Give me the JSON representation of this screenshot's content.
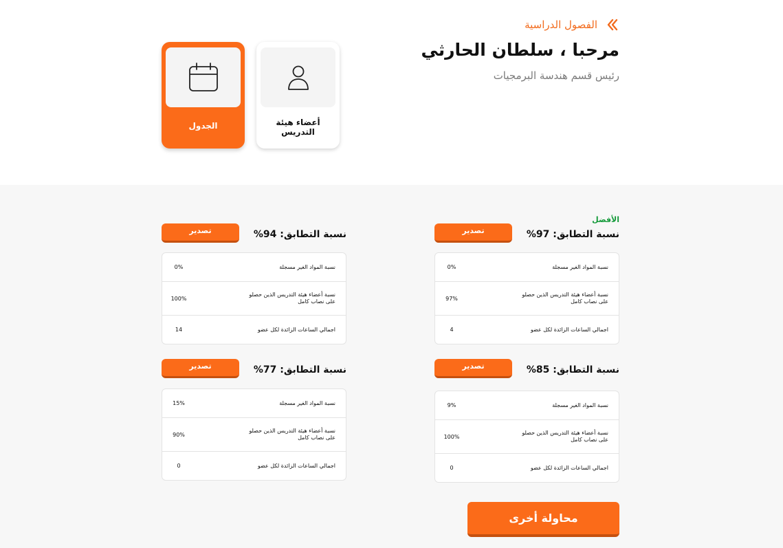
{
  "header": {
    "breadcrumb": "الفصول الدراسية",
    "title": "مرحبا ، سلطان الحارثي",
    "subtitle": "رئيس قسم هندسة البرمجيات"
  },
  "nav_cards": {
    "schedule": {
      "label": "الجدول",
      "icon": "calendar-icon"
    },
    "faculty": {
      "label": "أعضاء هيئة التدريس",
      "icon": "user-icon"
    }
  },
  "best_badge": "الأفضل",
  "results": [
    {
      "title": "نسبة التطابق: 97%",
      "export": "تصدير",
      "rows": [
        {
          "label": "نسبة المواد الغير مسجلة",
          "value": "0%"
        },
        {
          "label": "نسبة أعضاء هيئة التدريس الذين حصلو على نصاب كامل",
          "value": "97%"
        },
        {
          "label": "اجمالي الساعات الزائدة لكل عضو",
          "value": "4"
        }
      ]
    },
    {
      "title": "نسبة التطابق: 94%",
      "export": "تصدير",
      "rows": [
        {
          "label": "نسبة المواد الغير مسجلة",
          "value": "0%"
        },
        {
          "label": "نسبة أعضاء هيئة التدريس الذين حصلو على نصاب كامل",
          "value": "100%"
        },
        {
          "label": "اجمالي الساعات الزائدة لكل عضو",
          "value": "14"
        }
      ]
    },
    {
      "title": "نسبة التطابق: 85%",
      "export": "تصدير",
      "rows": [
        {
          "label": "نسبة المواد الغير مسجلة",
          "value": "9%"
        },
        {
          "label": "نسبة أعضاء هيئة التدريس الذين حصلو على نصاب كامل",
          "value": "100%"
        },
        {
          "label": "اجمالي الساعات الزائدة لكل عضو",
          "value": "0"
        }
      ]
    },
    {
      "title": "نسبة التطابق: 77%",
      "export": "تصدير",
      "rows": [
        {
          "label": "نسبة المواد الغير مسجلة",
          "value": "15%"
        },
        {
          "label": "نسبة أعضاء هيئة التدريس الذين حصلو على نصاب كامل",
          "value": "90%"
        },
        {
          "label": "اجمالي الساعات الزائدة لكل عضو",
          "value": "0"
        }
      ]
    }
  ],
  "retry_button": "محاولة أخرى",
  "colors": {
    "accent": "#fb6b19",
    "accent_dark": "#c5500f",
    "best": "#149a3a",
    "section_bg": "#f7f7f7"
  }
}
